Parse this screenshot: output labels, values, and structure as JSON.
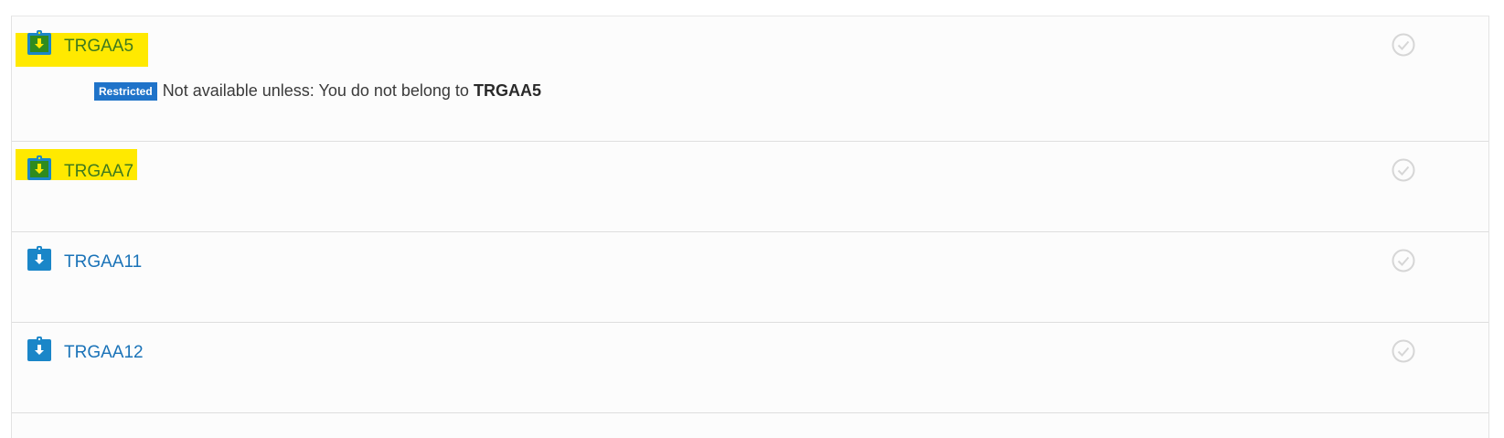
{
  "activities": [
    {
      "name": "TRGAA5",
      "icon": "assignment-download-icon",
      "highlighted": true,
      "restriction": {
        "badge": "Restricted",
        "text": "Not available unless: You do not belong to",
        "group": "TRGAA5"
      }
    },
    {
      "name": "TRGAA7",
      "icon": "assignment-download-icon",
      "highlighted": true
    },
    {
      "name": "TRGAA11",
      "icon": "assignment-download-icon",
      "highlighted": false
    },
    {
      "name": "TRGAA12",
      "icon": "assignment-download-icon",
      "highlighted": false
    }
  ],
  "colors": {
    "link": "#1a73b8",
    "highlight": "#ffe900",
    "icon_blue": "#1a86c8",
    "icon_green": "#2e8b1e",
    "badge": "#1f73c9",
    "completion_check": "#d6d6d6"
  }
}
